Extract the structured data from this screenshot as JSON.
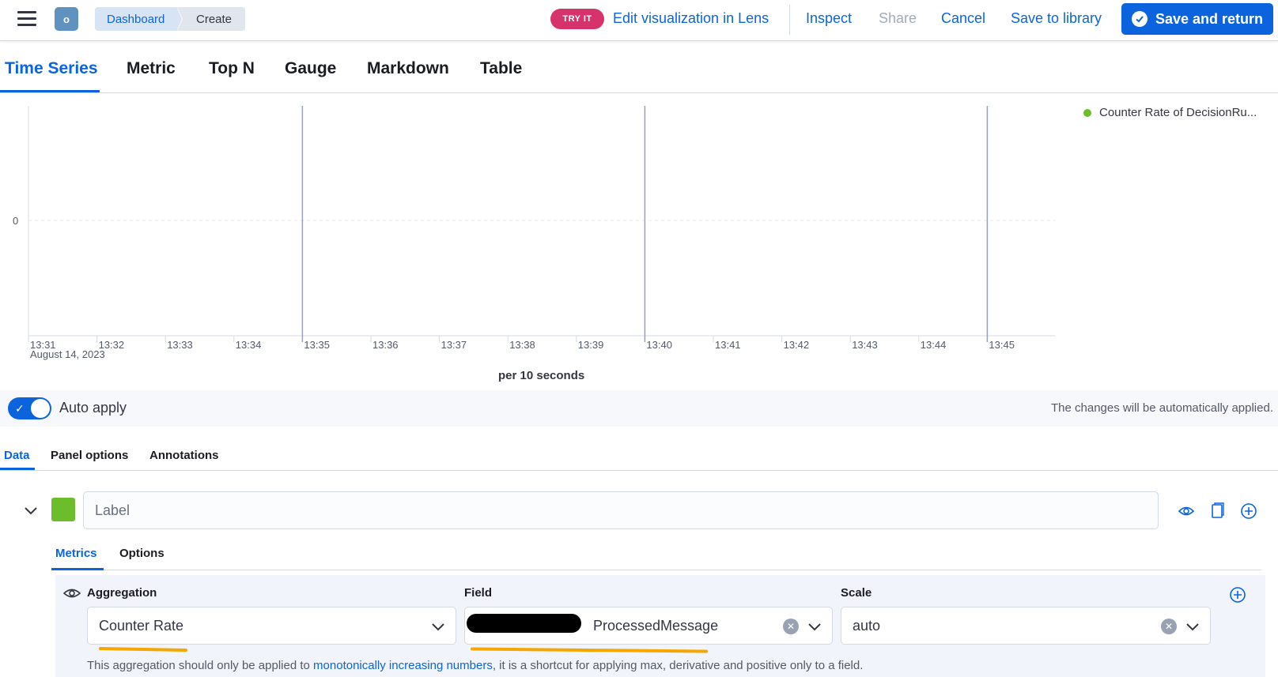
{
  "header": {
    "avatar_initial": "o",
    "breadcrumbs": [
      "Dashboard",
      "Create"
    ],
    "try_it_badge": "TRY IT",
    "edit_in_lens": "Edit visualization in Lens",
    "inspect": "Inspect",
    "share": "Share",
    "cancel": "Cancel",
    "save_to_library": "Save to library",
    "save_and_return": "Save and return"
  },
  "vis_tabs": [
    "Time Series",
    "Metric",
    "Top N",
    "Gauge",
    "Markdown",
    "Table"
  ],
  "chart_data": {
    "type": "line",
    "x": [
      "13:31",
      "13:32",
      "13:33",
      "13:34",
      "13:35",
      "13:36",
      "13:37",
      "13:38",
      "13:39",
      "13:40",
      "13:41",
      "13:42",
      "13:43",
      "13:44",
      "13:45"
    ],
    "date_label": "August 14, 2023",
    "y_tick": "0",
    "series": [
      {
        "name": "Counter Rate of DecisionRu...",
        "color": "#6cbd2c",
        "values": []
      }
    ],
    "interval_label": "per 10 seconds",
    "markers_at": [
      "13:35",
      "13:40",
      "13:45"
    ],
    "legend_position": "top-right"
  },
  "apply_bar": {
    "label": "Auto apply",
    "message": "The changes will be automatically applied.",
    "enabled": true
  },
  "editor_tabs": [
    "Data",
    "Panel options",
    "Annotations"
  ],
  "series": {
    "color": "#6cbd2c",
    "label_placeholder": "Label"
  },
  "metric_tabs": [
    "Metrics",
    "Options"
  ],
  "metric": {
    "aggregation_label": "Aggregation",
    "aggregation_value": "Counter Rate",
    "field_label": "Field",
    "field_value_visible": "ProcessedMessage",
    "scale_label": "Scale",
    "scale_value": "auto",
    "hint_before": "This aggregation should only be applied to ",
    "hint_link": "monotonically increasing numbers",
    "hint_after": ", it is a shortcut for applying max, derivative and positive only to a field."
  }
}
